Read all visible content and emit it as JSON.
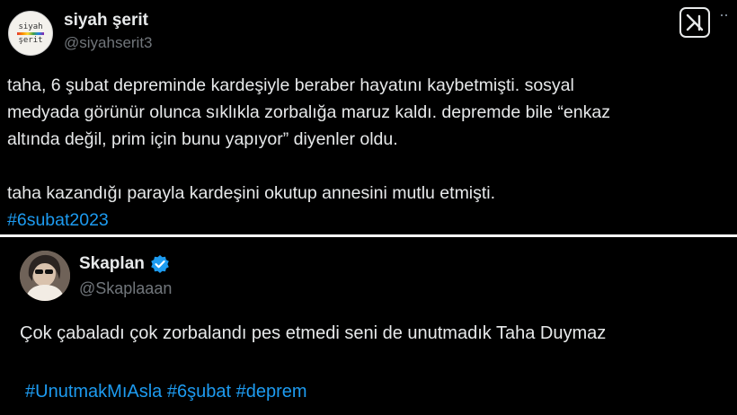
{
  "tweet1": {
    "avatar_text_top": "siyah",
    "avatar_text_bottom": "şerit",
    "display_name": "siyah şerit",
    "handle": "@siyahserit3",
    "more_label": "··",
    "lines": [
      "taha, 6 şubat depreminde kardeşiyle beraber hayatını kaybetmişti. sosyal",
      "medyada görünür olunca sıklıkla zorbalığa maruz kaldı. depremde bile “enkaz",
      "altında değil, prim için bunu yapıyor” diyenler oldu."
    ],
    "line_last": "taha kazandığı parayla kardeşini okutup annesini mutlu etmişti.",
    "hashtag": "#6subat2023"
  },
  "tweet2": {
    "display_name": "Skaplan",
    "verified_icon": "verified-badge-icon",
    "handle": "@Skaplaaan",
    "text": "Çok çabaladı çok zorbalandı pes etmedi seni de unutmadık Taha Duymaz",
    "hashtags": [
      "#UnutmakMıAsla",
      "#6şubat",
      "#deprem"
    ]
  },
  "colors": {
    "background": "#000000",
    "text": "#e7e9ea",
    "muted": "#71767b",
    "link": "#1d9bf0"
  }
}
